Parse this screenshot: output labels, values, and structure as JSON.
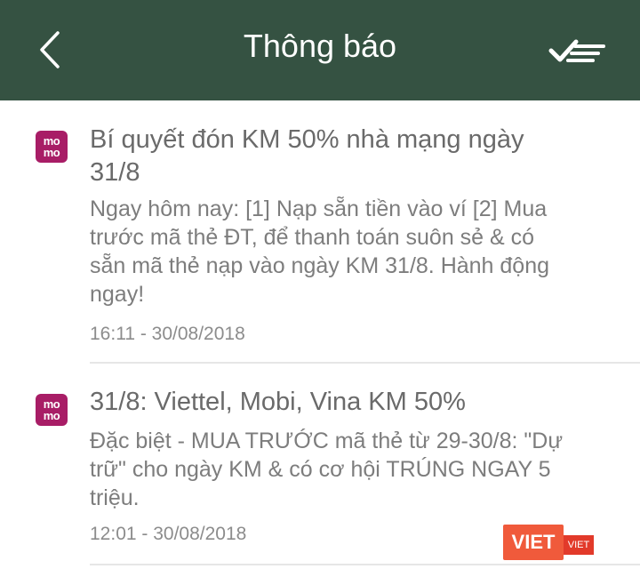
{
  "header": {
    "title": "Thông báo",
    "back_icon": "chevron-left-icon",
    "action_icon": "mark-all-read-icon",
    "background": "#355242"
  },
  "notifications": [
    {
      "logo_text_top": "mo",
      "logo_text_bottom": "mo",
      "title_line1": "Bí quyết đón KM 50% nhà mạng ngày",
      "title_line2": "31/8",
      "body_line1": "Ngay hôm nay: [1] Nạp sẵn tiền vào ví [2] Mua",
      "body_line2": "trước mã thẻ ĐT, để thanh toán suôn sẻ & có",
      "body_line3": "sẵn mã thẻ nạp vào ngày KM 31/8. Hành động",
      "body_line4": "ngay!",
      "time": "16:11 - 30/08/2018"
    },
    {
      "logo_text_top": "mo",
      "logo_text_bottom": "mo",
      "title_line1": "31/8: Viettel, Mobi, Vina KM 50%",
      "body_line1": "Đặc biệt - MUA TRƯỚC mã thẻ từ 29-30/8: \"Dự",
      "body_line2": "trữ\" cho ngày KM & có cơ hội TRÚNG NGAY 5",
      "body_line3": "triệu.",
      "time": "12:01 - 30/08/2018"
    }
  ],
  "watermark": {
    "text": "VIET",
    "subtext": "VIET",
    "color": "#f05a3b"
  },
  "colors": {
    "brand_logo": "#a81d66"
  }
}
